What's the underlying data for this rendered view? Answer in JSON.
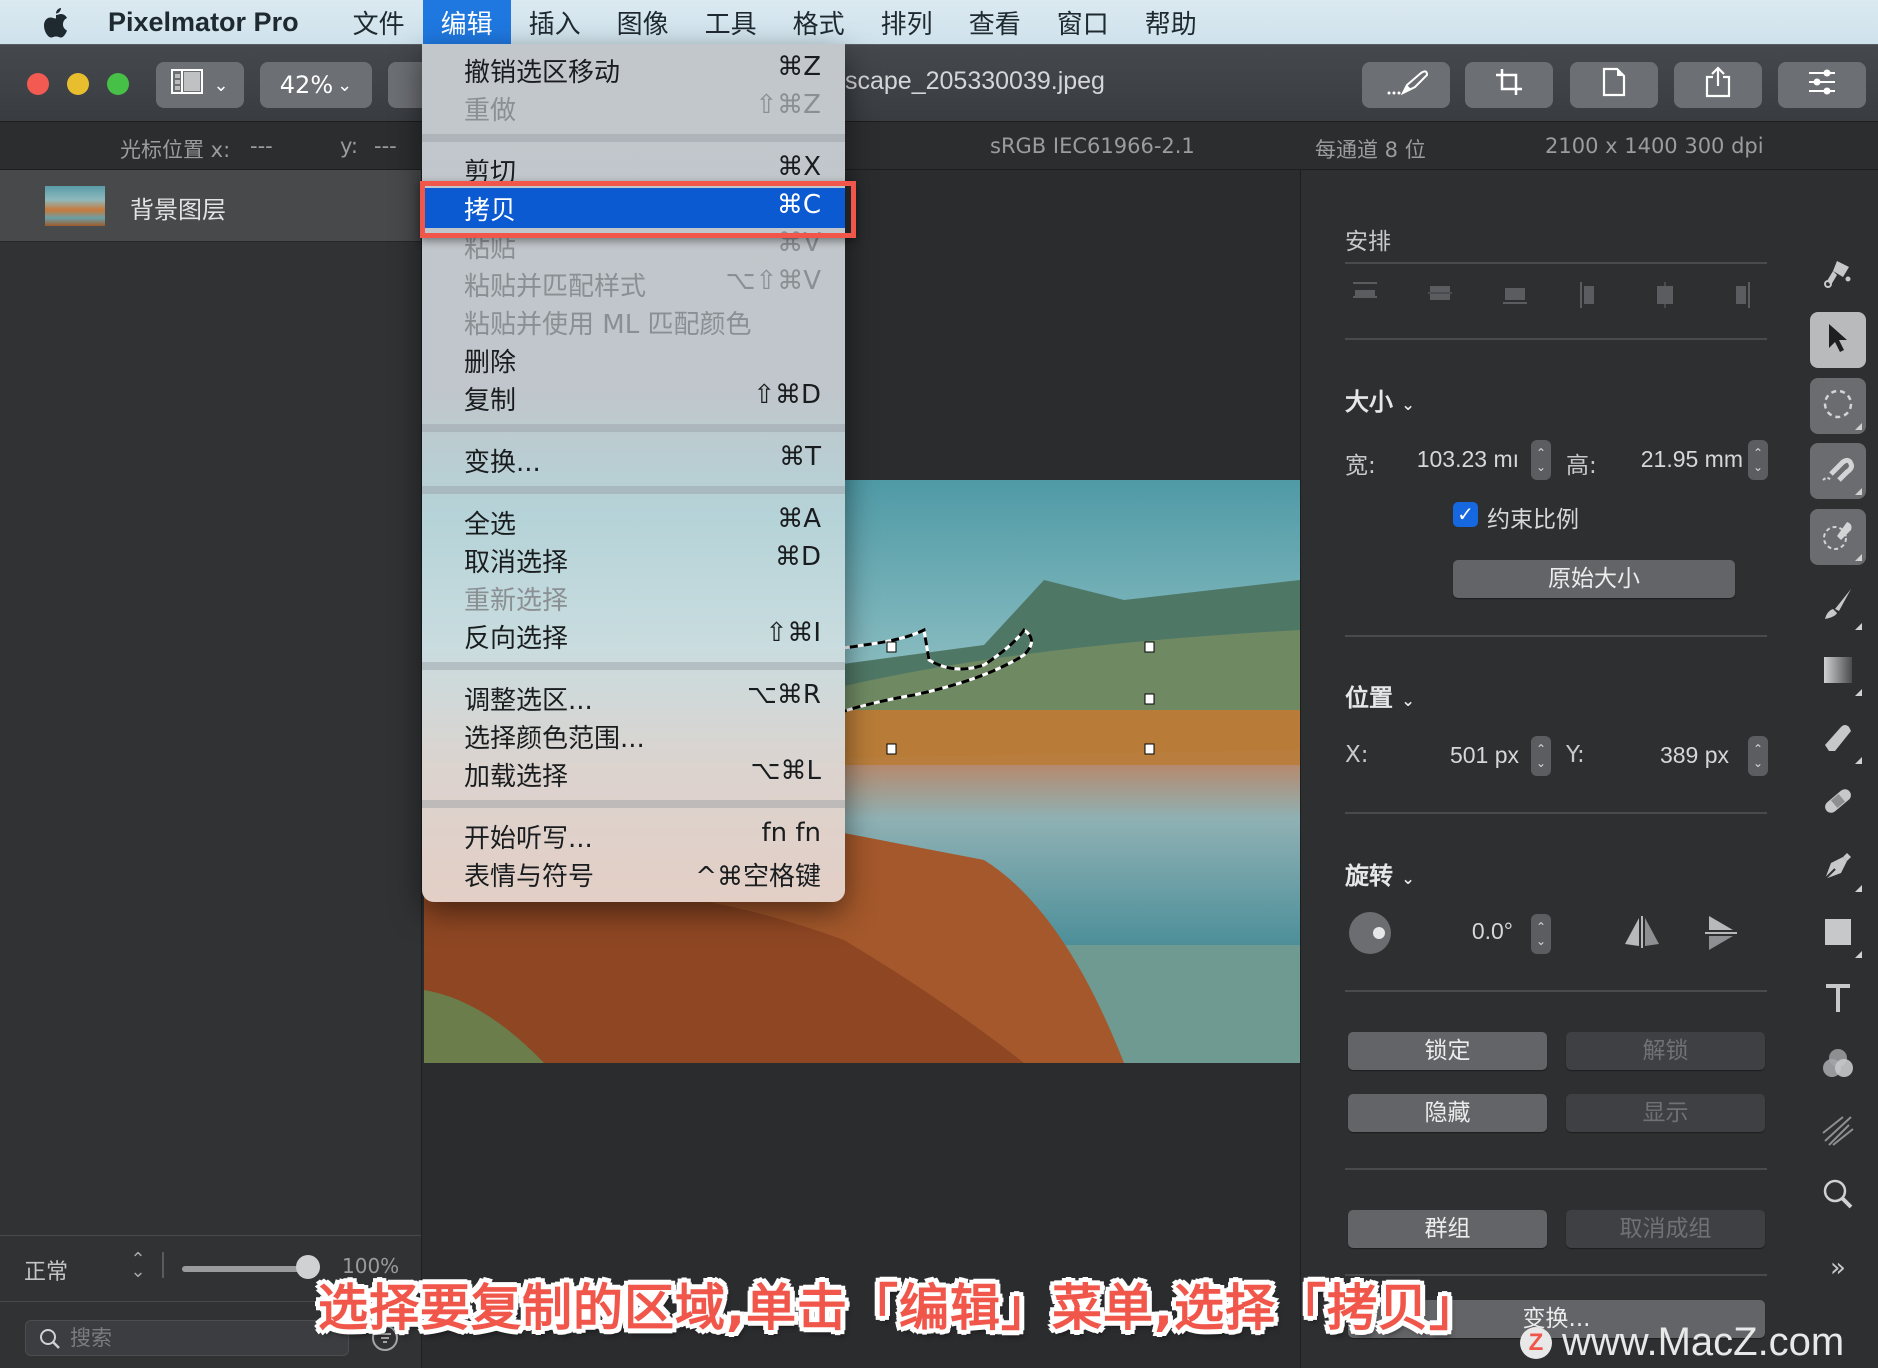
{
  "menubar": {
    "app_name": "Pixelmator Pro",
    "items": [
      "文件",
      "编辑",
      "插入",
      "图像",
      "工具",
      "格式",
      "排列",
      "查看",
      "窗口",
      "帮助"
    ],
    "active_index": 1
  },
  "toolbar": {
    "zoom_level": "42%",
    "document_title": "scape_205330039.jpeg",
    "buttons": [
      "tools-customize",
      "crop",
      "format",
      "share",
      "adjustments"
    ]
  },
  "infobar": {
    "cursor_label": "光标位置 x:",
    "cursor_x": "---",
    "cursor_y_label": "y:",
    "cursor_y": "---",
    "color_profile": "sRGB IEC61966-2.1",
    "bit_depth": "每通道 8 位",
    "dimensions": "2100 x 1400 300 dpi"
  },
  "layers": {
    "items": [
      {
        "name": "背景图层"
      }
    ],
    "blend_mode": "正常",
    "opacity": "100%",
    "opacity_fraction": 1.0,
    "search_placeholder": "搜索"
  },
  "edit_menu": {
    "items": [
      {
        "label": "撤销选区移动",
        "shortcut": "⌘Z",
        "enabled": true
      },
      {
        "label": "重做",
        "shortcut": "⇧⌘Z",
        "enabled": false
      },
      {
        "separator": true
      },
      {
        "label": "剪切",
        "shortcut": "⌘X",
        "enabled": true
      },
      {
        "label": "拷贝",
        "shortcut": "⌘C",
        "enabled": true,
        "selected": true
      },
      {
        "label": "粘贴",
        "shortcut": "⌘V",
        "enabled": false
      },
      {
        "label": "粘贴并匹配样式",
        "shortcut": "⌥⇧⌘V",
        "enabled": false
      },
      {
        "label": "粘贴并使用 ML 匹配颜色",
        "shortcut": "",
        "enabled": false
      },
      {
        "label": "删除",
        "shortcut": "",
        "enabled": true
      },
      {
        "label": "复制",
        "shortcut": "⇧⌘D",
        "enabled": true
      },
      {
        "separator": true
      },
      {
        "label": "变换...",
        "shortcut": "⌘T",
        "enabled": true
      },
      {
        "separator": true
      },
      {
        "label": "全选",
        "shortcut": "⌘A",
        "enabled": true
      },
      {
        "label": "取消选择",
        "shortcut": "⌘D",
        "enabled": true
      },
      {
        "label": "重新选择",
        "shortcut": "",
        "enabled": false
      },
      {
        "label": "反向选择",
        "shortcut": "⇧⌘I",
        "enabled": true
      },
      {
        "separator": true
      },
      {
        "label": "调整选区...",
        "shortcut": "⌥⌘R",
        "enabled": true
      },
      {
        "label": "选择颜色范围...",
        "shortcut": "",
        "enabled": true
      },
      {
        "label": "加载选择",
        "shortcut": "⌥⌘L",
        "enabled": true
      },
      {
        "separator": true
      },
      {
        "label": "开始听写...",
        "shortcut": "fn fn",
        "enabled": true
      },
      {
        "label": "表情与符号",
        "shortcut": "^⌘空格键",
        "enabled": true
      }
    ]
  },
  "inspector": {
    "arrange_title": "安排",
    "size_title": "大小",
    "width_label": "宽:",
    "width_value": "103.23 mı",
    "height_label": "高:",
    "height_value": "21.95 mm",
    "constrain_label": "约束比例",
    "constrain_checked": true,
    "original_size_button": "原始大小",
    "position_title": "位置",
    "x_label": "X:",
    "x_value": "501 px",
    "y_label": "Y:",
    "y_value": "389 px",
    "rotate_title": "旋转",
    "rotate_value": "0.0°",
    "lock_button": "锁定",
    "unlock_button": "解锁",
    "hide_button": "隐藏",
    "show_button": "显示",
    "group_button": "群组",
    "ungroup_button": "取消成组",
    "transform_button": "变换..."
  },
  "tools": [
    "style",
    "arrange",
    "selection",
    "magnetic-selection",
    "quick-selection",
    "paint",
    "gradient",
    "erase",
    "repair",
    "pen",
    "shape",
    "type",
    "color-adjust",
    "effects",
    "zoom",
    "more"
  ],
  "active_tool": "arrange",
  "overlay": {
    "caption": "选择要复制的区域,单击「编辑」菜单,选择「拷贝」",
    "watermark": "www.MacZ.com",
    "watermark_logo": "Z"
  },
  "colors": {
    "menu_highlight": "#0b5ad2",
    "annotation_red": "#f0564a",
    "checkbox_blue": "#1668e0"
  }
}
